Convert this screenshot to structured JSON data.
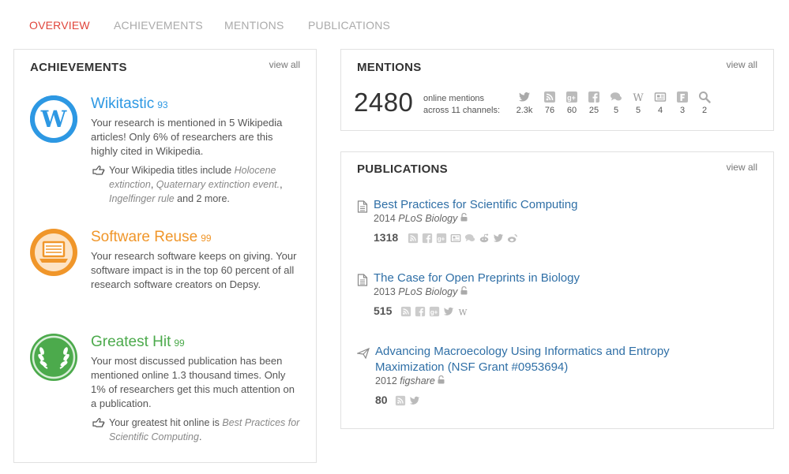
{
  "tabs": [
    {
      "label": "OVERVIEW",
      "active": true
    },
    {
      "label": "ACHIEVEMENTS",
      "active": false
    },
    {
      "label": "MENTIONS",
      "active": false
    },
    {
      "label": "PUBLICATIONS",
      "active": false
    }
  ],
  "achievements_panel": {
    "title": "ACHIEVEMENTS",
    "view_all": "view all",
    "items": [
      {
        "title": "Wikitastic",
        "score": "93",
        "color": "#2d98e3",
        "icon": "wikipedia-icon",
        "text": "Your research is mentioned in 5 Wikipedia articles! Only 6% of researchers are this highly cited in Wikipedia.",
        "note_prefix": "Your Wikipedia titles include ",
        "note_em1": "Holocene extinction",
        "note_sep1": ", ",
        "note_em2": "Quaternary extinction event.",
        "note_sep2": ", ",
        "note_em3": "Ingelfinger rule",
        "note_suffix": " and 2 more."
      },
      {
        "title": "Software Reuse",
        "score": "99",
        "color": "#f0962a",
        "icon": "laptop-icon",
        "text": "Your research software keeps on giving. Your software impact is in the top 60 percent of all research software creators on Depsy."
      },
      {
        "title": "Greatest Hit",
        "score": "99",
        "color": "#4caa4c",
        "icon": "laurel-wreath-icon",
        "text": "Your most discussed publication has been mentioned online 1.3 thousand times. Only 1% of researchers get this much attention on a publication.",
        "note_prefix": "Your greatest hit online is ",
        "note_em1": "Best Practices for Scientific Computing",
        "note_suffix": "."
      }
    ]
  },
  "mentions_panel": {
    "title": "MENTIONS",
    "view_all": "view all",
    "total": "2480",
    "label_line1": "online mentions",
    "label_line2": "across 11 channels:",
    "channels": [
      {
        "icon": "twitter-icon",
        "count": "2.3k"
      },
      {
        "icon": "rss-icon",
        "count": "76"
      },
      {
        "icon": "google-plus-icon",
        "count": "60"
      },
      {
        "icon": "facebook-icon",
        "count": "25"
      },
      {
        "icon": "comments-icon",
        "count": "5"
      },
      {
        "icon": "wikipedia-icon",
        "count": "5"
      },
      {
        "icon": "newspaper-icon",
        "count": "4"
      },
      {
        "icon": "f1000-icon",
        "count": "3"
      },
      {
        "icon": "search-icon",
        "count": "2"
      }
    ]
  },
  "publications_panel": {
    "title": "PUBLICATIONS",
    "view_all": "view all",
    "items": [
      {
        "title": "Best Practices for Scientific Computing",
        "year": "2014",
        "venue": "PLoS Biology",
        "count": "1318",
        "icons": [
          "rss-icon",
          "facebook-icon",
          "google-plus-icon",
          "newspaper-icon",
          "comments-icon",
          "reddit-icon",
          "twitter-icon",
          "weibo-icon"
        ]
      },
      {
        "title": "The Case for Open Preprints in Biology",
        "year": "2013",
        "venue": "PLoS Biology",
        "count": "515",
        "icons": [
          "rss-icon",
          "facebook-icon",
          "google-plus-icon",
          "twitter-icon",
          "wikipedia-icon"
        ]
      },
      {
        "title_line1": "Advancing Macroecology Using Informatics and Entropy",
        "title_line2": "Maximization (NSF Grant #0953694)",
        "year": "2012",
        "venue": "figshare",
        "count": "80",
        "icons": [
          "rss-icon",
          "twitter-icon"
        ]
      }
    ]
  }
}
